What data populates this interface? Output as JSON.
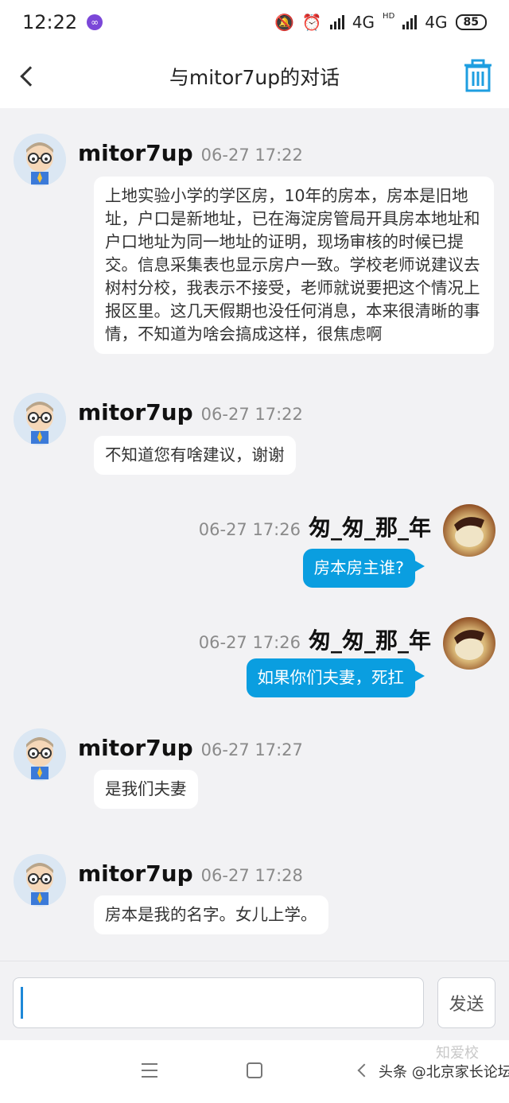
{
  "status_bar": {
    "time": "12:22",
    "network_1": "4G",
    "network_2": "4G",
    "hd_label": "HD",
    "battery": "85"
  },
  "header": {
    "title": "与mitor7up的对话"
  },
  "messages": [
    {
      "sender": "mitor7up",
      "time": "06-27 17:22",
      "text": "上地实验小学的学区房，10年的房本，房本是旧地址，户口是新地址，已在海淀房管局开具房本地址和户口地址为同一地址的证明，现场审核的时候已提交。信息采集表也显示房户一致。学校老师说建议去树村分校，我表示不接受，老师就说要把这个情况上报区里。这几天假期也没任何消息，本来很清晰的事情，不知道为啥会搞成这样，很焦虑啊"
    },
    {
      "sender": "mitor7up",
      "time": "06-27 17:22",
      "text": "不知道您有啥建议，谢谢"
    },
    {
      "sender": "匆_匆_那_年",
      "time": "06-27 17:26",
      "text": "房本房主谁?"
    },
    {
      "sender": "匆_匆_那_年",
      "time": "06-27 17:26",
      "text": "如果你们夫妻，死扛"
    },
    {
      "sender": "mitor7up",
      "time": "06-27 17:27",
      "text": "是我们夫妻"
    },
    {
      "sender": "mitor7up",
      "time": "06-27 17:28",
      "text": "房本是我的名字。女儿上学。"
    }
  ],
  "input": {
    "value": "",
    "send_label": "发送"
  },
  "watermark": {
    "text": "头条 @北京家长论坛",
    "faint_text": "知爱校"
  },
  "colors": {
    "accent": "#0a9ee0",
    "background": "#f2f2f4"
  }
}
